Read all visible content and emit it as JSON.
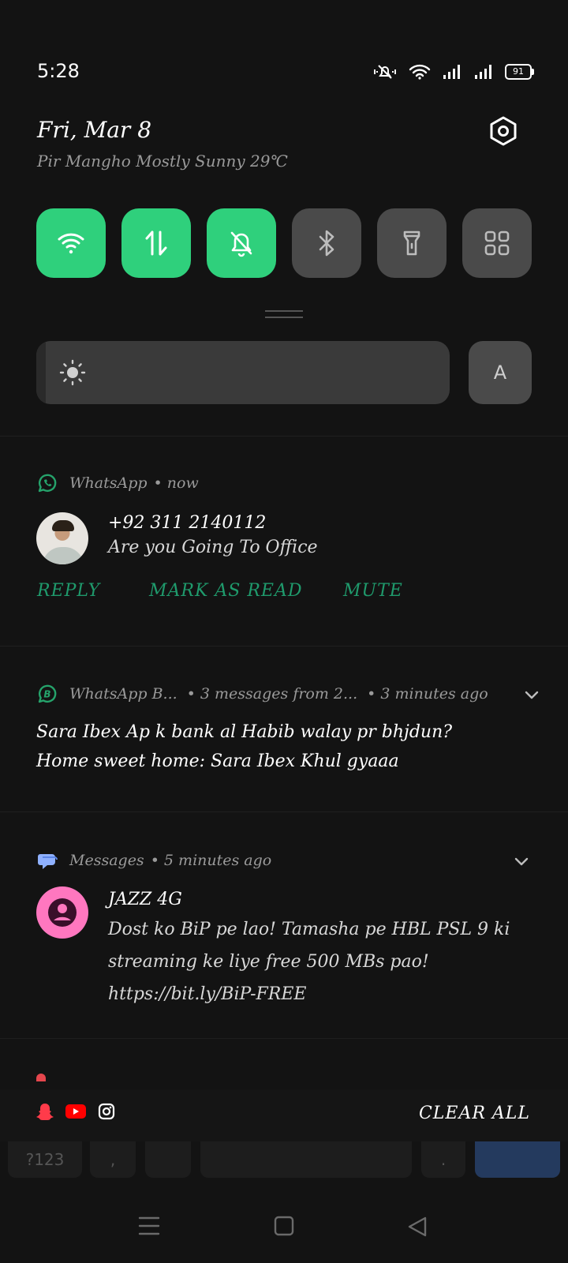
{
  "status_bar": {
    "time": "5:28",
    "battery": "91",
    "icons": [
      "mute-notification-icon",
      "wifi-icon",
      "signal-icon",
      "signal-icon",
      "battery-icon"
    ]
  },
  "header": {
    "date": "Fri, Mar 8",
    "weather": "Pir Mangho Mostly Sunny 29℃",
    "settings_icon": "gear-icon"
  },
  "quick_tiles": [
    {
      "name": "wifi",
      "icon": "wifi-icon",
      "active": true
    },
    {
      "name": "mobile-data",
      "icon": "data-arrows-icon",
      "active": true
    },
    {
      "name": "mute",
      "icon": "bell-off-icon",
      "active": true
    },
    {
      "name": "bluetooth",
      "icon": "bluetooth-icon",
      "active": false
    },
    {
      "name": "flashlight",
      "icon": "flashlight-icon",
      "active": false
    },
    {
      "name": "more",
      "icon": "grid-icon",
      "active": false
    }
  ],
  "brightness": {
    "level": 0.02,
    "auto_label": "A"
  },
  "notifications": [
    {
      "app": "WhatsApp",
      "time": "• now",
      "sender": "+92 311 2140112",
      "message": "Are you Going To Office",
      "actions": [
        "REPLY",
        "MARK AS READ",
        "MUTE"
      ]
    },
    {
      "app": "WhatsApp B...",
      "summary": "• 3 messages from 2...",
      "time": "• 3 minutes ago",
      "lines": [
        "Sara Ibex Ap k bank al Habib walay pr bhjdun?",
        "Home sweet home: Sara Ibex Khul gyaaa"
      ]
    },
    {
      "app": "Messages",
      "time": "• 5 minutes ago",
      "sender": "JAZZ 4G",
      "message": "Dost ko BiP pe lao! Tamasha pe HBL PSL 9 ki streaming ke liye free 500 MBs pao! https://bit.ly/BiP-FREE"
    }
  ],
  "bottom_bar": {
    "app_icons": [
      "snapchat-icon",
      "youtube-icon",
      "instagram-icon"
    ],
    "clear_all": "CLEAR ALL"
  },
  "keyboard_peek": {
    "symbols_key": "?123",
    "comma_key": ",",
    "period_key": "."
  },
  "nav_bar": [
    "menu-icon",
    "home-icon",
    "back-icon"
  ]
}
